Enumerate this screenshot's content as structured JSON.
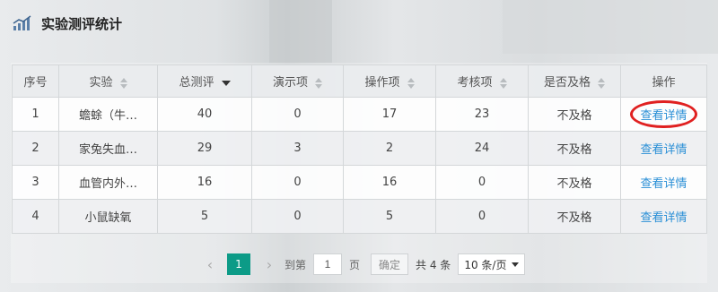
{
  "header": {
    "title": "实验测评统计",
    "icon": "chart-icon"
  },
  "table": {
    "columns": [
      "序号",
      "实验",
      "总测评",
      "演示项",
      "操作项",
      "考核项",
      "是否及格",
      "操作"
    ],
    "rows": [
      {
        "no": "1",
        "name": "蟾蜍（牛…",
        "total": "40",
        "demo": "0",
        "op": "17",
        "exam": "23",
        "pass": "不及格",
        "action": "查看详情"
      },
      {
        "no": "2",
        "name": "家兔失血…",
        "total": "29",
        "demo": "3",
        "op": "2",
        "exam": "24",
        "pass": "不及格",
        "action": "查看详情"
      },
      {
        "no": "3",
        "name": "血管内外…",
        "total": "16",
        "demo": "0",
        "op": "16",
        "exam": "0",
        "pass": "不及格",
        "action": "查看详情"
      },
      {
        "no": "4",
        "name": "小鼠缺氧",
        "total": "5",
        "demo": "0",
        "op": "5",
        "exam": "0",
        "pass": "不及格",
        "action": "查看详情"
      }
    ]
  },
  "pager": {
    "current_page": "1",
    "goto_label": "到第",
    "goto_value": "1",
    "page_label": "页",
    "confirm_label": "确定",
    "total_text": "共 4 条",
    "page_size": "10 条/页",
    "prev_icon": "chevron-left-icon",
    "next_icon": "chevron-right-icon"
  },
  "colors": {
    "accent": "#0c9b87",
    "link": "#2a8fd6",
    "highlight_circle": "#e02020"
  }
}
